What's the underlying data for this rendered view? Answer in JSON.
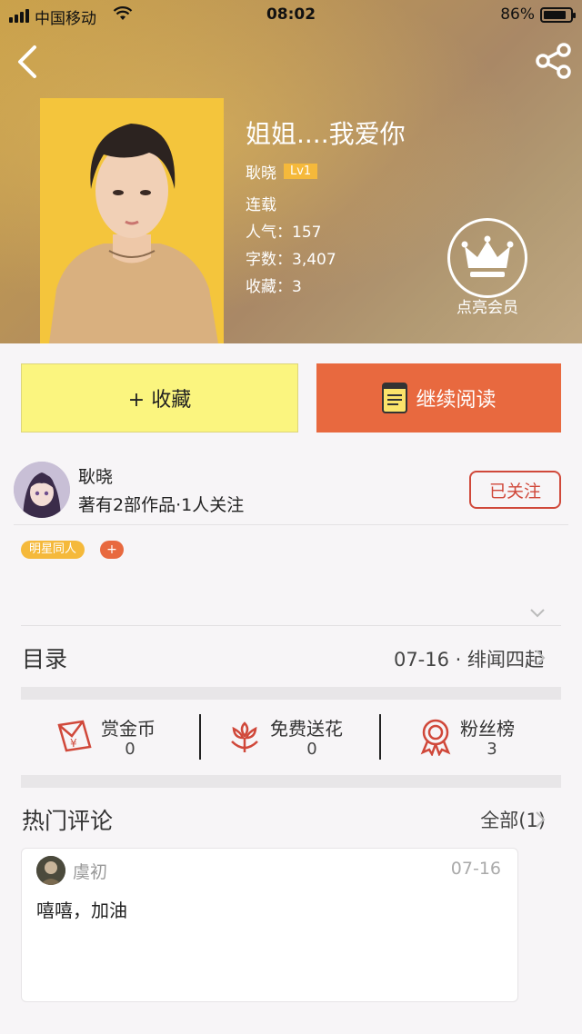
{
  "status_bar": {
    "carrier": "中国移动",
    "time": "08:02",
    "battery_percent": "86%",
    "battery_level": 0.86
  },
  "header": {
    "back_icon": "chevron-left-icon",
    "share_icon": "share-icon"
  },
  "book": {
    "title": "姐姐....我爱你",
    "author": "耿晓",
    "level": "Lv1",
    "status": "连载",
    "popularity": "人气：157",
    "word_count": "字数：3,407",
    "favorites": "收藏：3"
  },
  "vip": {
    "icon": "crown-icon",
    "label": "点亮会员"
  },
  "actions": {
    "favorite_label": "+ 收藏",
    "read_label": "继续阅读",
    "read_icon": "book-icon"
  },
  "author_card": {
    "name": "耿晓",
    "works": "著有2部作品·1人关注",
    "follow_label": "已关注"
  },
  "tags": {
    "items": [
      "明星同人"
    ],
    "add_label": "+"
  },
  "toc": {
    "label": "目录",
    "latest": "07-16 · 绯闻四起"
  },
  "stats": [
    {
      "name": "赏金币",
      "value": "0",
      "icon": "red-envelope-icon"
    },
    {
      "name": "免费送花",
      "value": "0",
      "icon": "flower-icon"
    },
    {
      "name": "粉丝榜",
      "value": "3",
      "icon": "medal-icon"
    }
  ],
  "comments_section": {
    "label": "热门评论",
    "all_label": "全部(1)",
    "items": [
      {
        "user": "虞初",
        "date": "07-16",
        "text": "嘻嘻，加油"
      }
    ]
  },
  "colors": {
    "accent_orange": "#e8693f",
    "favorite_yellow": "#fbf57f",
    "tag_yellow": "#f5b93b",
    "follow_red": "#d0483a"
  }
}
